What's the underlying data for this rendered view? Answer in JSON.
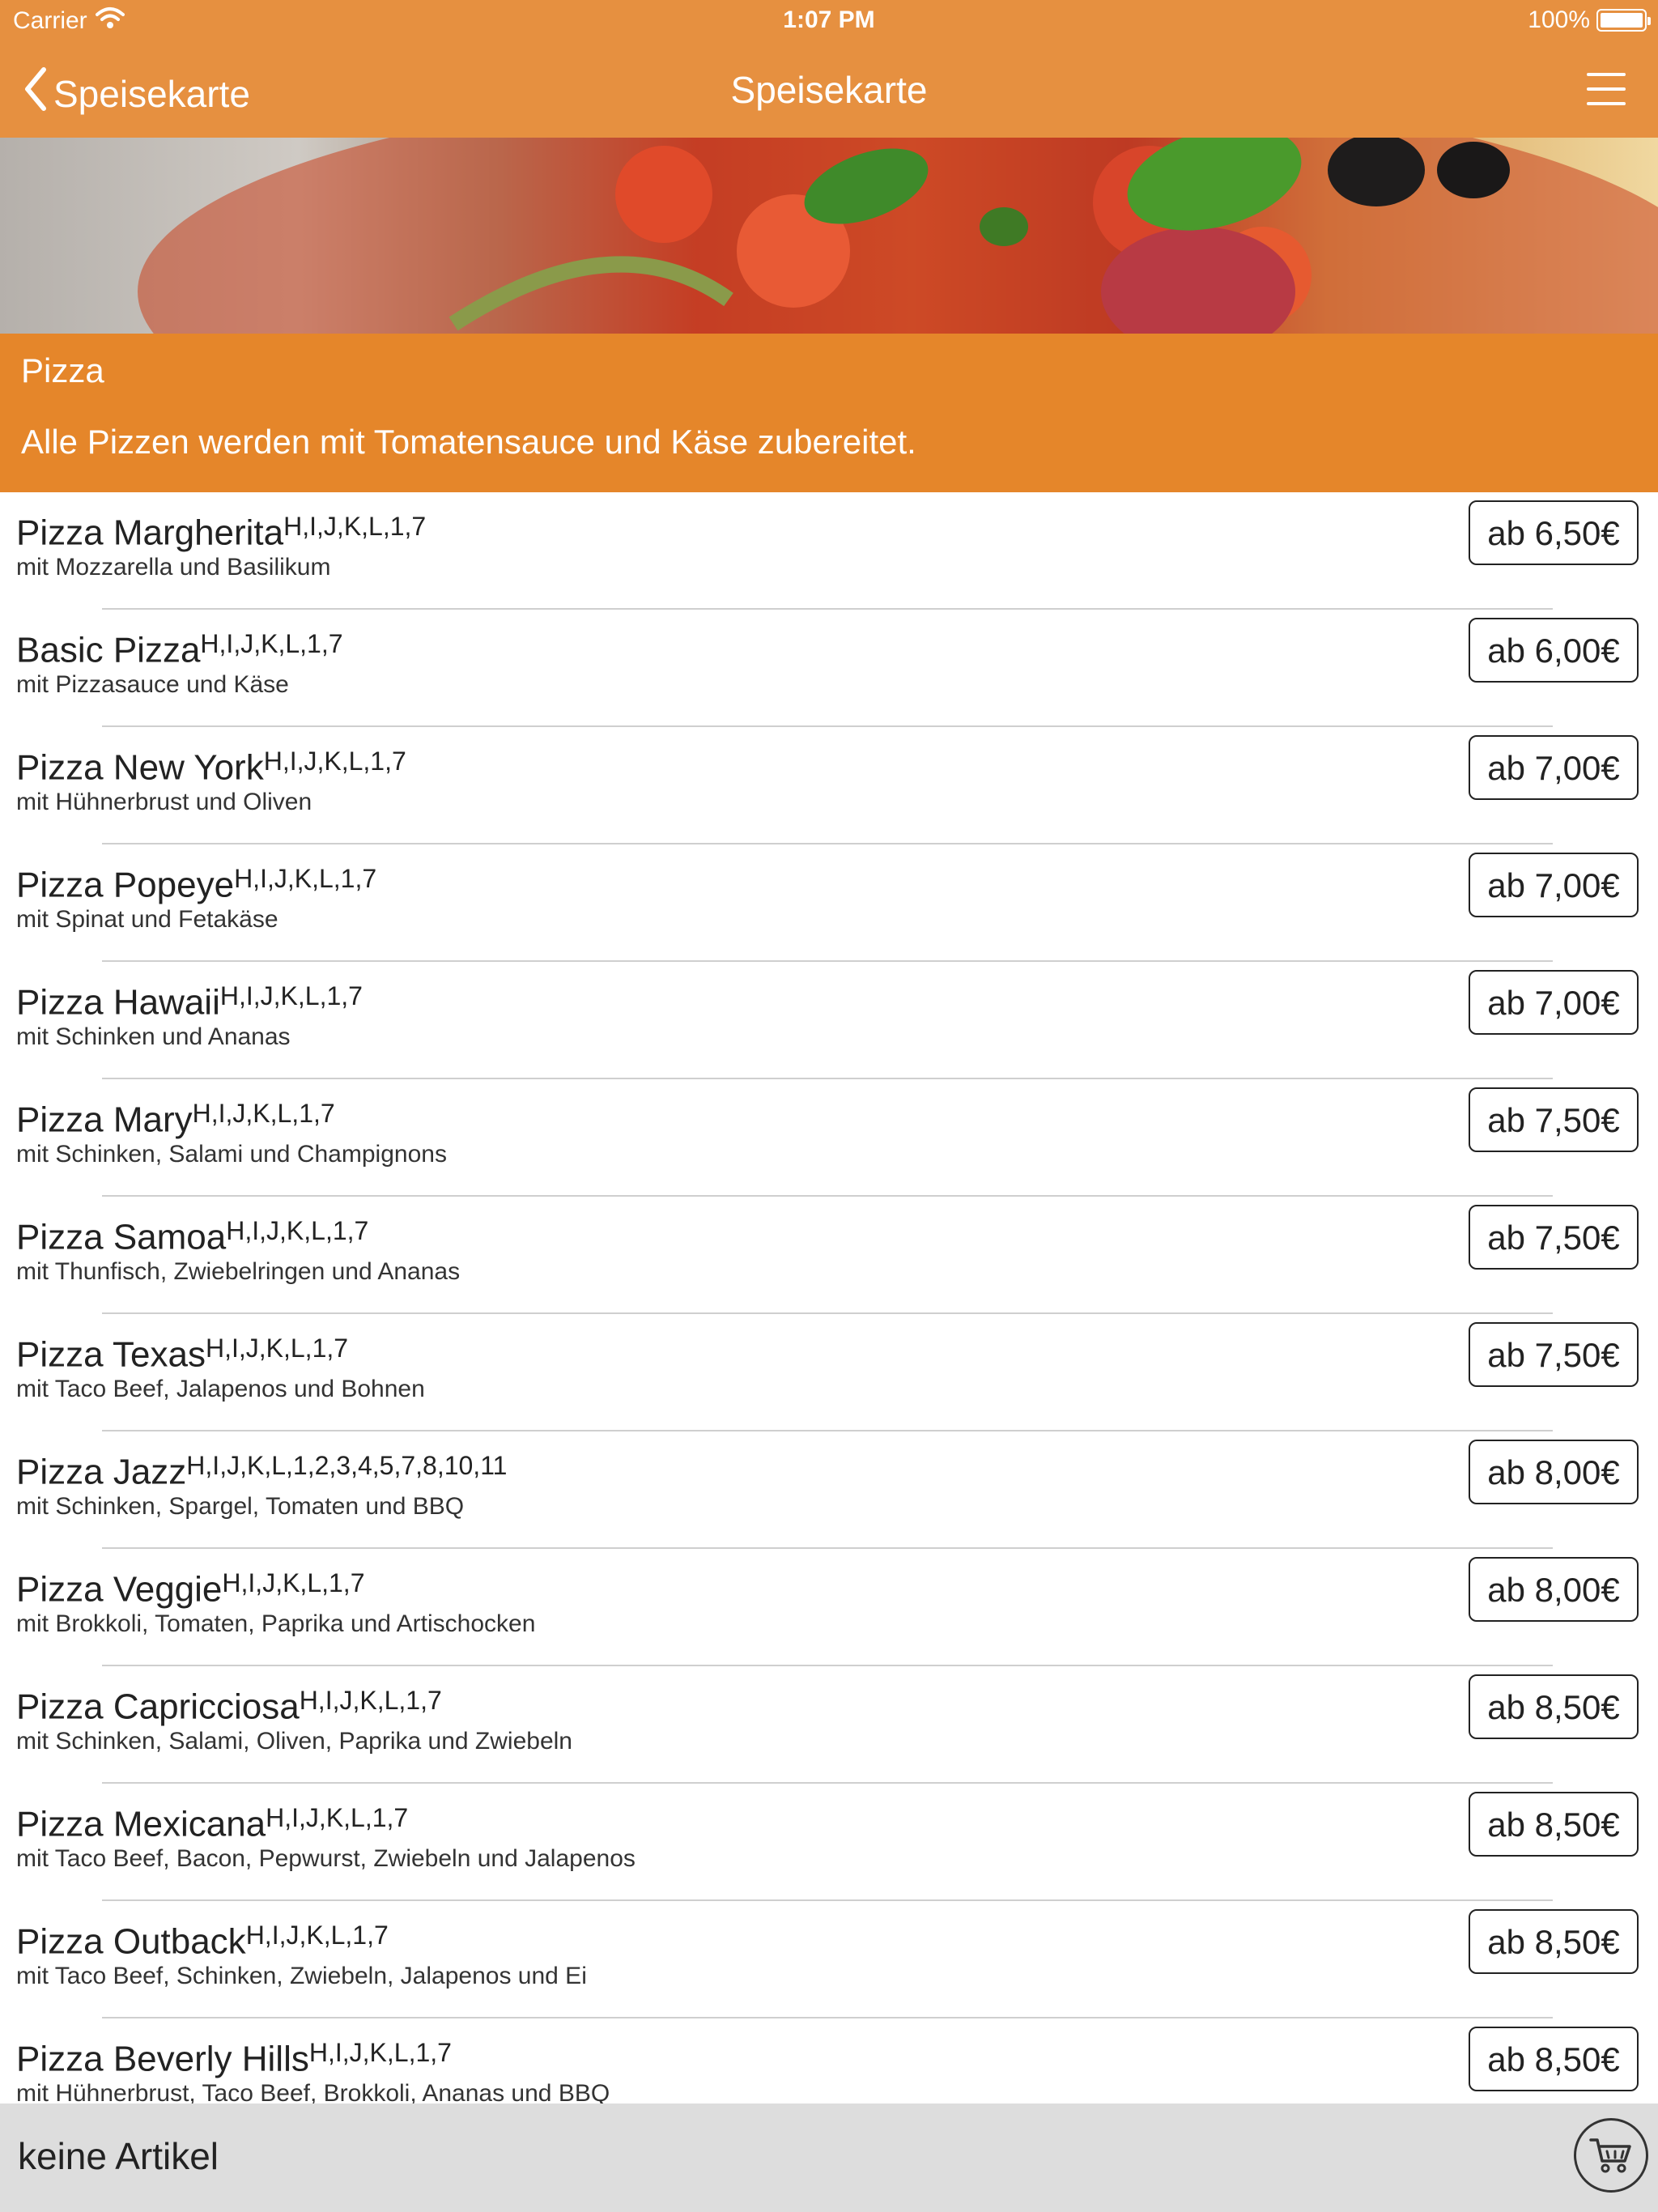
{
  "status_bar": {
    "carrier": "Carrier",
    "time": "1:07 PM",
    "battery": "100%"
  },
  "nav": {
    "back_label": "Speisekarte",
    "title": "Speisekarte"
  },
  "category": {
    "title": "Pizza",
    "description": "Alle Pizzen werden mit Tomatensauce und Käse zubereitet."
  },
  "items": [
    {
      "name": "Pizza Margherita",
      "allergens": "H,I,J,K,L,1,7",
      "desc": "mit Mozzarella und Basilikum",
      "price": "ab 6,50€"
    },
    {
      "name": "Basic Pizza",
      "allergens": "H,I,J,K,L,1,7",
      "desc": "mit Pizzasauce und Käse",
      "price": "ab 6,00€"
    },
    {
      "name": "Pizza New York",
      "allergens": "H,I,J,K,L,1,7",
      "desc": "mit Hühnerbrust und Oliven",
      "price": "ab 7,00€"
    },
    {
      "name": "Pizza Popeye",
      "allergens": "H,I,J,K,L,1,7",
      "desc": "mit Spinat und Fetakäse",
      "price": "ab 7,00€"
    },
    {
      "name": "Pizza Hawaii",
      "allergens": "H,I,J,K,L,1,7",
      "desc": "mit Schinken und Ananas",
      "price": "ab 7,00€"
    },
    {
      "name": "Pizza Mary",
      "allergens": "H,I,J,K,L,1,7",
      "desc": "mit Schinken, Salami und Champignons",
      "price": "ab 7,50€"
    },
    {
      "name": "Pizza Samoa",
      "allergens": "H,I,J,K,L,1,7",
      "desc": "mit Thunfisch, Zwiebelringen und Ananas",
      "price": "ab 7,50€"
    },
    {
      "name": "Pizza Texas",
      "allergens": "H,I,J,K,L,1,7",
      "desc": "mit Taco Beef, Jalapenos und Bohnen",
      "price": "ab 7,50€"
    },
    {
      "name": "Pizza Jazz",
      "allergens": "H,I,J,K,L,1,2,3,4,5,7,8,10,11",
      "desc": "mit Schinken, Spargel, Tomaten und BBQ",
      "price": "ab 8,00€"
    },
    {
      "name": "Pizza Veggie",
      "allergens": "H,I,J,K,L,1,7",
      "desc": "mit Brokkoli, Tomaten, Paprika und Artischocken",
      "price": "ab 8,00€"
    },
    {
      "name": "Pizza Capricciosa",
      "allergens": "H,I,J,K,L,1,7",
      "desc": "mit Schinken, Salami, Oliven, Paprika und Zwiebeln",
      "price": "ab 8,50€"
    },
    {
      "name": "Pizza Mexicana",
      "allergens": "H,I,J,K,L,1,7",
      "desc": "mit Taco Beef, Bacon, Pepwurst, Zwiebeln und Jalapenos",
      "price": "ab 8,50€"
    },
    {
      "name": "Pizza Outback",
      "allergens": "H,I,J,K,L,1,7",
      "desc": "mit Taco Beef, Schinken, Zwiebeln, Jalapenos und Ei",
      "price": "ab 8,50€"
    },
    {
      "name": "Pizza Beverly Hills",
      "allergens": "H,I,J,K,L,1,7",
      "desc": "mit Hühnerbrust, Taco Beef, Brokkoli, Ananas und BBQ",
      "price": "ab 8,50€"
    }
  ],
  "footer": {
    "cart_status": "keine Artikel"
  },
  "colors": {
    "nav_orange": "#E69040",
    "category_orange": "#E5862A",
    "footer_gray": "#DDDDDD"
  },
  "icons": {
    "back": "chevron-left-icon",
    "menu": "hamburger-menu-icon",
    "wifi": "wifi-icon",
    "battery": "battery-icon",
    "cart": "shopping-cart-icon"
  }
}
